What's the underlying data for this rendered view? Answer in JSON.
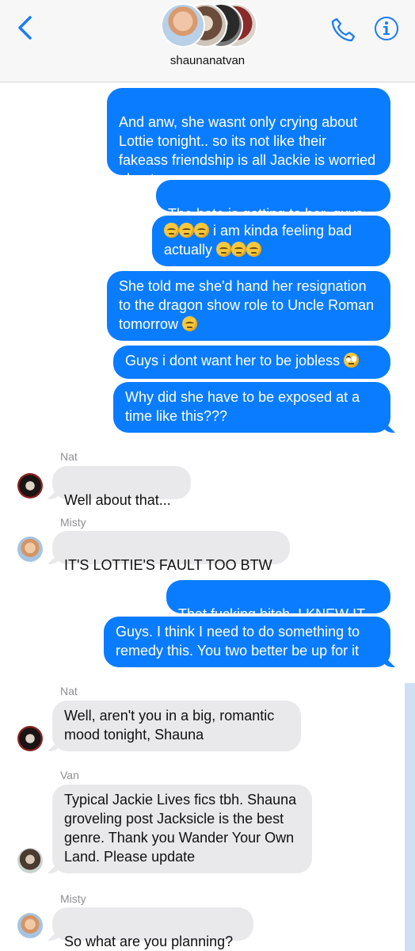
{
  "header": {
    "title": "shaunanatvan",
    "back_icon": "chevron-left-icon",
    "call_icon": "phone-icon",
    "info_icon": "info-icon",
    "accent": "#1a7cf5"
  },
  "colors": {
    "outgoing": "#0a7cff",
    "incoming": "#e9e9eb"
  },
  "messages": [
    {
      "from": "me",
      "text": "And anw, she wasnt only crying about Lottie tonight.. so its not like their fakeass friendship is all Jackie is worried about..."
    },
    {
      "from": "me",
      "text": "The hate is getting to her, guys"
    },
    {
      "from": "me",
      "text_pre": "",
      "text": "i am kinda feeling bad",
      "text2": "actually",
      "emoji": "pensive-face-emoji"
    },
    {
      "from": "me",
      "text": "She told me she'd hand her resignation to the dragon show role to Uncle Roman tomorrow",
      "emoji": "pensive-face-emoji"
    },
    {
      "from": "me",
      "text": "Guys i dont want her to be jobless",
      "emoji": "face-with-rolling-eyes-emoji"
    },
    {
      "from": "me",
      "text": "Why did she have to be exposed at a time like this???"
    },
    {
      "from": "Nat",
      "sender": "Nat",
      "text": "Well about that..."
    },
    {
      "from": "Misty",
      "sender": "Misty",
      "text": "IT'S LOTTIE'S FAULT TOO BTW"
    },
    {
      "from": "me",
      "text": "That fucking bitch. I KNEW IT"
    },
    {
      "from": "me",
      "text": "Guys. I think I need to do something to remedy this. You two better be up for it"
    },
    {
      "from": "Nat",
      "sender": "Nat",
      "text": "Well, aren't you in a big, romantic mood tonight, Shauna"
    },
    {
      "from": "Van",
      "sender": "Van",
      "text": "Typical Jackie Lives fics tbh. Shauna groveling post Jacksicle is the best genre. Thank you Wander Your Own Land. Please update"
    },
    {
      "from": "Misty",
      "sender": "Misty",
      "text": "So what are you planning?"
    }
  ]
}
